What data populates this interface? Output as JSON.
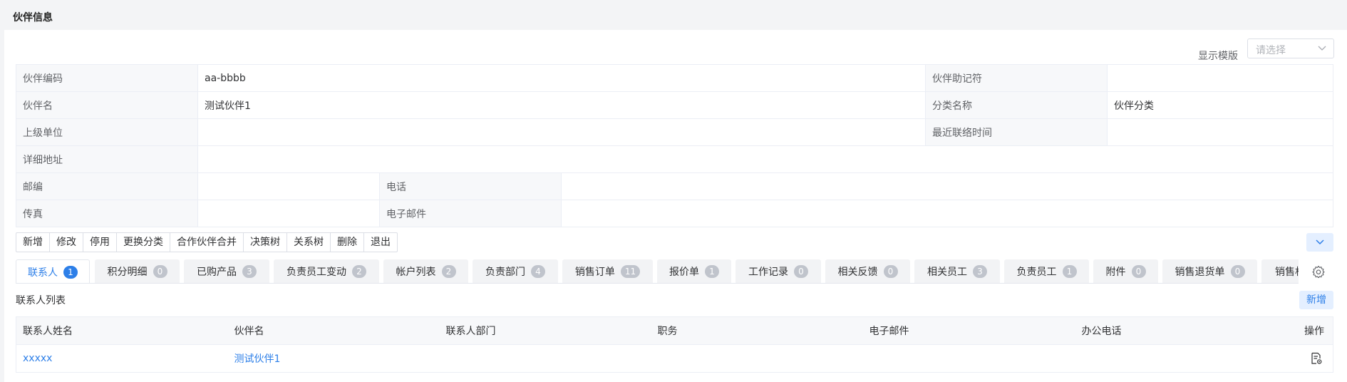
{
  "page": {
    "title": "伙伴信息"
  },
  "template": {
    "label": "显示模版",
    "placeholder": "请选择"
  },
  "info": {
    "code_label": "伙伴编码",
    "code": "aa-bbbb",
    "mnemonic_label": "伙伴助记符",
    "mnemonic": "",
    "name_label": "伙伴名",
    "name": "测试伙伴1",
    "category_label": "分类名称",
    "category": "伙伴分类",
    "parent_label": "上级单位",
    "parent": "",
    "last_contact_label": "最近联络时间",
    "last_contact": "",
    "address_label": "详细地址",
    "address": "",
    "postcode_label": "邮编",
    "postcode": "",
    "phone_label": "电话",
    "phone": "",
    "fax_label": "传真",
    "fax": "",
    "email_label": "电子邮件",
    "email": ""
  },
  "toolbar": [
    "新增",
    "修改",
    "停用",
    "更换分类",
    "合作伙伴合并",
    "决策树",
    "关系树",
    "删除",
    "退出"
  ],
  "tabs": [
    {
      "label": "联系人",
      "count": "1"
    },
    {
      "label": "积分明细",
      "count": "0"
    },
    {
      "label": "已购产品",
      "count": "3"
    },
    {
      "label": "负责员工变动",
      "count": "2"
    },
    {
      "label": "帐户列表",
      "count": "2"
    },
    {
      "label": "负责部门",
      "count": "4"
    },
    {
      "label": "销售订单",
      "count": "11"
    },
    {
      "label": "报价单",
      "count": "1"
    },
    {
      "label": "工作记录",
      "count": "0"
    },
    {
      "label": "相关反馈",
      "count": "0"
    },
    {
      "label": "相关员工",
      "count": "3"
    },
    {
      "label": "负责员工",
      "count": "1"
    },
    {
      "label": "附件",
      "count": "0"
    },
    {
      "label": "销售退货单",
      "count": "0"
    },
    {
      "label": "销售机",
      "count": ""
    }
  ],
  "contacts": {
    "title": "联系人列表",
    "new_label": "新增",
    "columns": [
      "联系人姓名",
      "伙伴名",
      "联系人部门",
      "职务",
      "电子邮件",
      "办公电话",
      "操作"
    ],
    "rows": [
      {
        "contact_name": "xxxxx",
        "partner_name": "测试伙伴1",
        "department": "",
        "position": "",
        "email": "",
        "office_phone": ""
      }
    ]
  },
  "icons": {
    "select_chevron": "chevron-down-icon",
    "collapse": "chevron-down-icon",
    "settings": "gear-icon",
    "row_action": "document-view-icon"
  },
  "colors": {
    "primary": "#2d7fe8",
    "badge_inactive": "#c0c4cc",
    "light_primary_bg": "#e4efff"
  }
}
